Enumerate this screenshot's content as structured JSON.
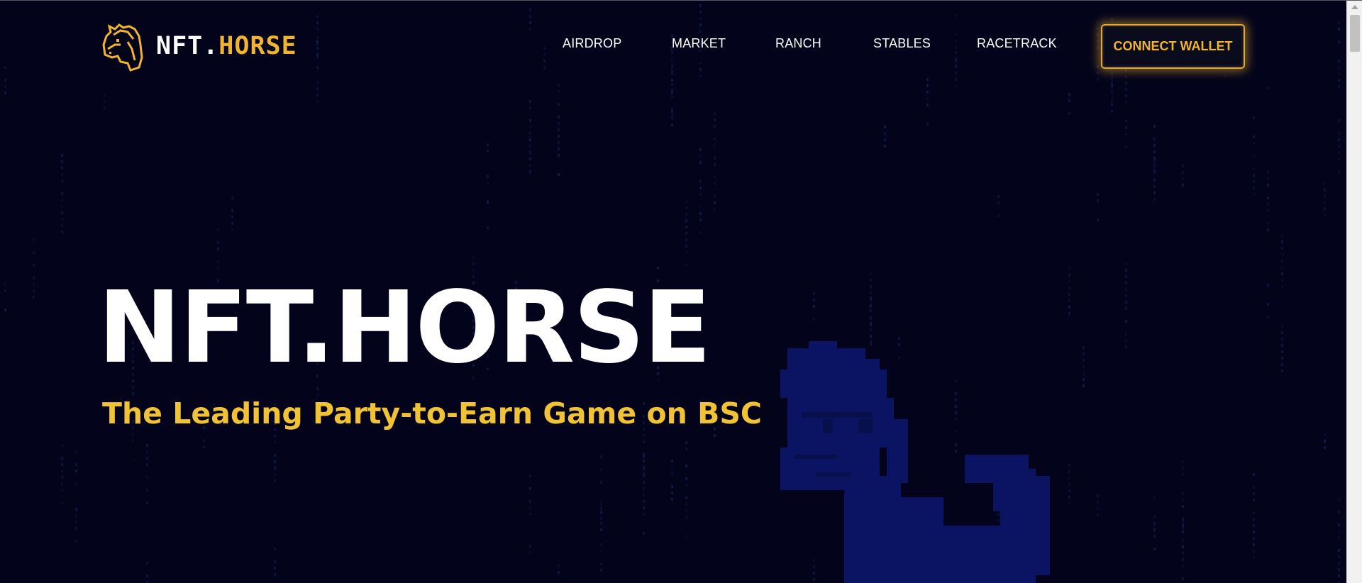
{
  "header": {
    "logo": {
      "icon": "horse-head-icon",
      "text_white": "NFT.",
      "text_yellow": "HORSE"
    },
    "nav": [
      {
        "label": "AIRDROP"
      },
      {
        "label": "MARKET"
      },
      {
        "label": "RANCH"
      },
      {
        "label": "STABLES"
      },
      {
        "label": "RACETRACK"
      }
    ],
    "connect_wallet_label": "CONNECT WALLET"
  },
  "hero": {
    "title": "NFT.HORSE",
    "subtitle": "The Leading Party-to-Earn Game on BSC"
  },
  "colors": {
    "background": "#03041b",
    "accent": "#f0b42e",
    "text": "#ffffff",
    "dots": "#1b2a6b",
    "horse_silhouette": "#0b1463"
  }
}
